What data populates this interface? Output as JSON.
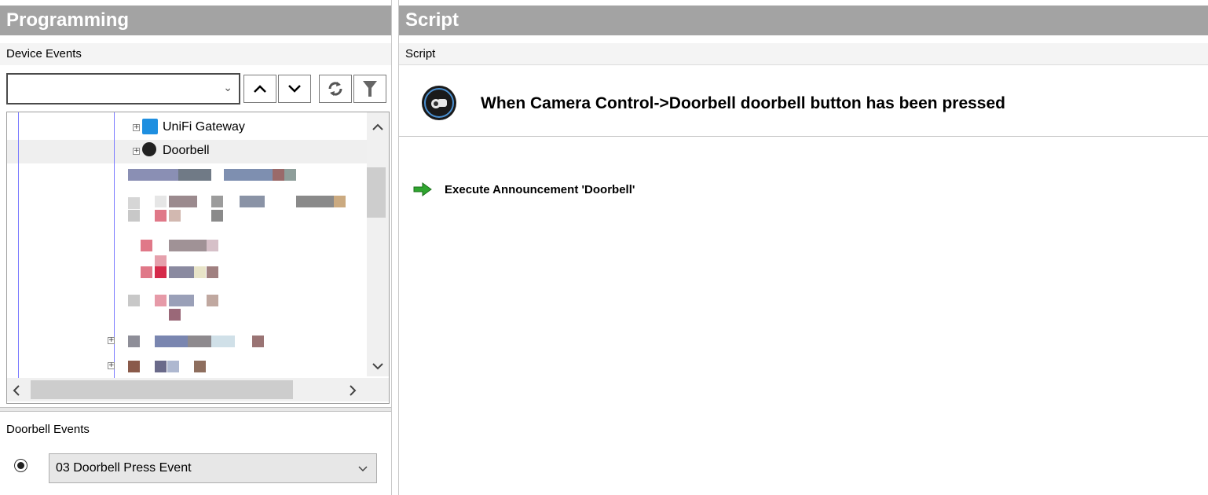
{
  "programming": {
    "title": "Programming",
    "device_events_label": "Device Events",
    "device_combo_value": "",
    "tree": {
      "items": [
        {
          "label": "UniFi Gateway",
          "icon": "network-gateway-icon",
          "expanded": false
        },
        {
          "label": "Doorbell",
          "icon": "camera-icon",
          "expanded": false
        }
      ]
    },
    "doorbell_events_label": "Doorbell Events",
    "event_select_value": "03 Doorbell Press Event"
  },
  "script": {
    "title": "Script",
    "sub_label": "Script",
    "when_text": "When Camera Control->Doorbell doorbell button has been pressed",
    "action_text": "Execute Announcement 'Doorbell'"
  },
  "colors": {
    "header_bg": "#a3a3a3",
    "selected_row": "#efefef",
    "tree_line": "#7b7bff",
    "action_arrow": "#2fa52f"
  }
}
